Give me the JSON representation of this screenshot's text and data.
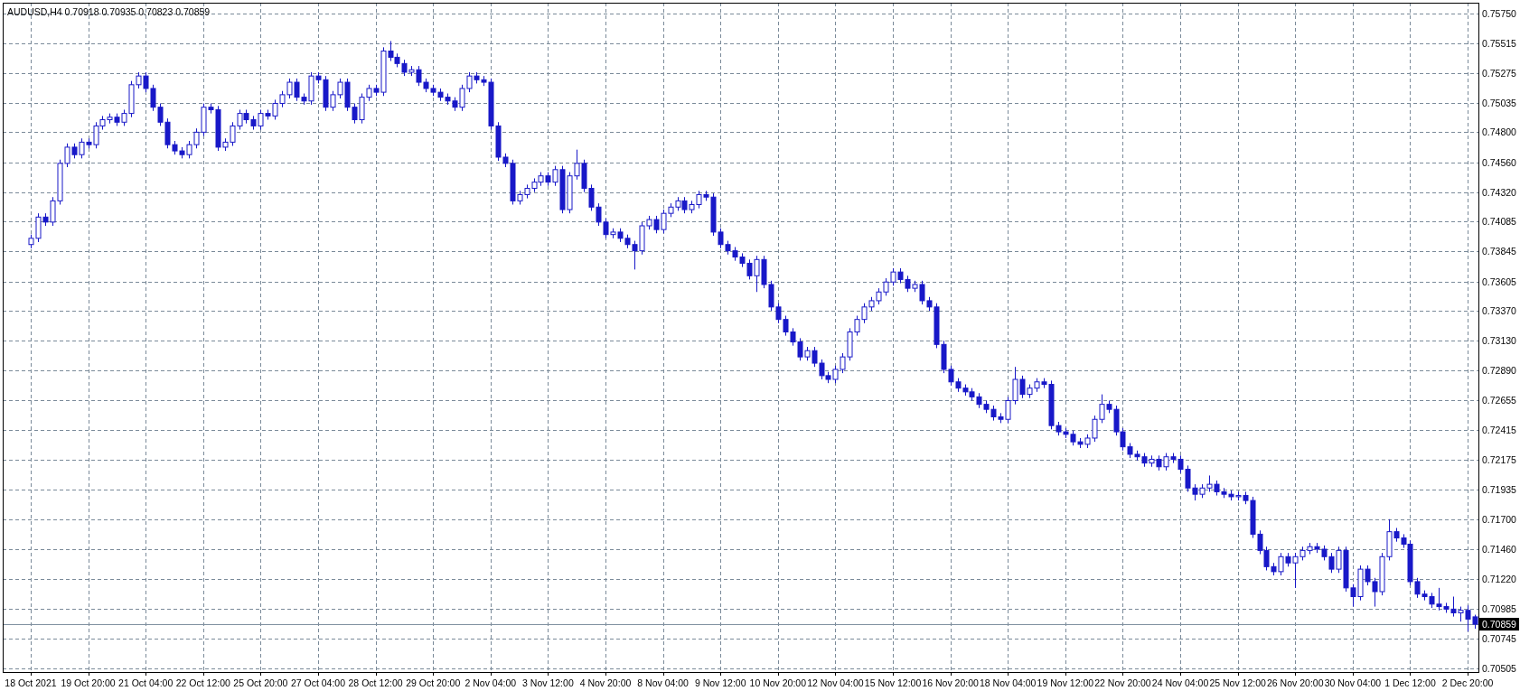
{
  "header_values": "0.70918 0.70935 0.70823 0.70859",
  "chart_data": {
    "type": "candlestick",
    "title": "AUDUSD,H4",
    "grid": true,
    "ylim": [
      0.70476,
      0.75837
    ],
    "ref_lines": [
      {
        "axis": "y",
        "value": 0.70859,
        "label": "0.70859"
      }
    ],
    "yticks": [
      {
        "value": 0.7575,
        "label": "0.75750"
      },
      {
        "value": 0.75515,
        "label": "0.75515"
      },
      {
        "value": 0.75275,
        "label": "0.75275"
      },
      {
        "value": 0.75035,
        "label": "0.75035"
      },
      {
        "value": 0.748,
        "label": "0.74800"
      },
      {
        "value": 0.7456,
        "label": "0.74560"
      },
      {
        "value": 0.7432,
        "label": "0.74320"
      },
      {
        "value": 0.74085,
        "label": "0.74085"
      },
      {
        "value": 0.73845,
        "label": "0.73845"
      },
      {
        "value": 0.73605,
        "label": "0.73605"
      },
      {
        "value": 0.7337,
        "label": "0.73370"
      },
      {
        "value": 0.7313,
        "label": "0.73130"
      },
      {
        "value": 0.7289,
        "label": "0.72890"
      },
      {
        "value": 0.72655,
        "label": "0.72655"
      },
      {
        "value": 0.72415,
        "label": "0.72415"
      },
      {
        "value": 0.72175,
        "label": "0.72175"
      },
      {
        "value": 0.71935,
        "label": "0.71935"
      },
      {
        "value": 0.717,
        "label": "0.71700"
      },
      {
        "value": 0.7146,
        "label": "0.71460"
      },
      {
        "value": 0.7122,
        "label": "0.71220"
      },
      {
        "value": 0.70985,
        "label": "0.70985"
      },
      {
        "value": 0.70745,
        "label": "0.70745"
      },
      {
        "value": 0.70505,
        "label": "0.70505"
      }
    ],
    "categories": [
      "18 Oct 2021",
      null,
      null,
      null,
      null,
      null,
      null,
      null,
      "19 Oct 20:00",
      null,
      null,
      null,
      null,
      null,
      null,
      null,
      "21 Oct 04:00",
      null,
      null,
      null,
      null,
      null,
      null,
      null,
      "22 Oct 12:00",
      null,
      null,
      null,
      null,
      null,
      null,
      null,
      "25 Oct 20:00",
      null,
      null,
      null,
      null,
      null,
      null,
      null,
      "27 Oct 04:00",
      null,
      null,
      null,
      null,
      null,
      null,
      null,
      "28 Oct 12:00",
      null,
      null,
      null,
      null,
      null,
      null,
      null,
      "29 Oct 20:00",
      null,
      null,
      null,
      null,
      null,
      null,
      null,
      "2 Nov 04:00",
      null,
      null,
      null,
      null,
      null,
      null,
      null,
      "3 Nov 12:00",
      null,
      null,
      null,
      null,
      null,
      null,
      null,
      "4 Nov 20:00",
      null,
      null,
      null,
      null,
      null,
      null,
      null,
      "8 Nov 04:00",
      null,
      null,
      null,
      null,
      null,
      null,
      null,
      "9 Nov 12:00",
      null,
      null,
      null,
      null,
      null,
      null,
      null,
      "10 Nov 20:00",
      null,
      null,
      null,
      null,
      null,
      null,
      null,
      "12 Nov 04:00",
      null,
      null,
      null,
      null,
      null,
      null,
      null,
      "15 Nov 12:00",
      null,
      null,
      null,
      null,
      null,
      null,
      null,
      "16 Nov 20:00",
      null,
      null,
      null,
      null,
      null,
      null,
      null,
      "18 Nov 04:00",
      null,
      null,
      null,
      null,
      null,
      null,
      null,
      "19 Nov 12:00",
      null,
      null,
      null,
      null,
      null,
      null,
      null,
      "22 Nov 20:00",
      null,
      null,
      null,
      null,
      null,
      null,
      null,
      "24 Nov 04:00",
      null,
      null,
      null,
      null,
      null,
      null,
      null,
      "25 Nov 12:00",
      null,
      null,
      null,
      null,
      null,
      null,
      null,
      "26 Nov 20:00",
      null,
      null,
      null,
      null,
      null,
      null,
      null,
      "30 Nov 04:00",
      null,
      null,
      null,
      null,
      null,
      null,
      null,
      "1 Dec 12:00",
      null,
      null,
      null,
      null,
      null,
      null,
      null,
      "2 Dec 20:00",
      null
    ],
    "ohlc": [
      [
        0.739,
        0.7398,
        0.7387,
        0.7395
      ],
      [
        0.7395,
        0.7415,
        0.7392,
        0.7412
      ],
      [
        0.7412,
        0.7415,
        0.7405,
        0.7408
      ],
      [
        0.7408,
        0.7428,
        0.7405,
        0.7425
      ],
      [
        0.7425,
        0.7458,
        0.7422,
        0.7455
      ],
      [
        0.7455,
        0.7471,
        0.7452,
        0.7468
      ],
      [
        0.7468,
        0.7471,
        0.7459,
        0.7462
      ],
      [
        0.7462,
        0.7475,
        0.7459,
        0.7472
      ],
      [
        0.7472,
        0.7475,
        0.7467,
        0.747
      ],
      [
        0.747,
        0.7488,
        0.7467,
        0.7485
      ],
      [
        0.7485,
        0.7493,
        0.7482,
        0.749
      ],
      [
        0.749,
        0.7495,
        0.7487,
        0.7492
      ],
      [
        0.7492,
        0.7495,
        0.7485,
        0.7488
      ],
      [
        0.7488,
        0.7498,
        0.7485,
        0.7495
      ],
      [
        0.7495,
        0.7521,
        0.7492,
        0.7518
      ],
      [
        0.7518,
        0.7528,
        0.7515,
        0.7525
      ],
      [
        0.7525,
        0.7528,
        0.7512,
        0.7515
      ],
      [
        0.7515,
        0.7518,
        0.7497,
        0.75
      ],
      [
        0.75,
        0.7503,
        0.7485,
        0.7488
      ],
      [
        0.7488,
        0.7491,
        0.7467,
        0.747
      ],
      [
        0.747,
        0.7473,
        0.7462,
        0.7465
      ],
      [
        0.7465,
        0.7468,
        0.7459,
        0.7462
      ],
      [
        0.7462,
        0.7473,
        0.7459,
        0.747
      ],
      [
        0.747,
        0.7483,
        0.7467,
        0.748
      ],
      [
        0.748,
        0.7503,
        0.7477,
        0.75
      ],
      [
        0.75,
        0.7503,
        0.7495,
        0.7498
      ],
      [
        0.7498,
        0.7501,
        0.7465,
        0.7468
      ],
      [
        0.7468,
        0.7475,
        0.7465,
        0.7472
      ],
      [
        0.7472,
        0.7488,
        0.7469,
        0.7485
      ],
      [
        0.7485,
        0.7498,
        0.7482,
        0.7495
      ],
      [
        0.7495,
        0.7498,
        0.7487,
        0.749
      ],
      [
        0.749,
        0.7493,
        0.7482,
        0.7485
      ],
      [
        0.7485,
        0.7498,
        0.7482,
        0.7495
      ],
      [
        0.7495,
        0.7498,
        0.749,
        0.7493
      ],
      [
        0.7493,
        0.7506,
        0.749,
        0.7503
      ],
      [
        0.7503,
        0.7513,
        0.75,
        0.751
      ],
      [
        0.751,
        0.7523,
        0.7507,
        0.752
      ],
      [
        0.752,
        0.7523,
        0.7505,
        0.7508
      ],
      [
        0.7508,
        0.7511,
        0.7502,
        0.7505
      ],
      [
        0.7505,
        0.7528,
        0.7502,
        0.7525
      ],
      [
        0.7525,
        0.7528,
        0.7519,
        0.7522
      ],
      [
        0.7522,
        0.7525,
        0.7497,
        0.75
      ],
      [
        0.75,
        0.7513,
        0.7497,
        0.751
      ],
      [
        0.751,
        0.7523,
        0.7507,
        0.752
      ],
      [
        0.752,
        0.7523,
        0.7497,
        0.75
      ],
      [
        0.75,
        0.7503,
        0.7487,
        0.749
      ],
      [
        0.749,
        0.7511,
        0.7487,
        0.7508
      ],
      [
        0.7508,
        0.7518,
        0.7505,
        0.7515
      ],
      [
        0.7515,
        0.7518,
        0.7509,
        0.7512
      ],
      [
        0.7512,
        0.7548,
        0.7509,
        0.7545
      ],
      [
        0.7545,
        0.7553,
        0.7537,
        0.754
      ],
      [
        0.754,
        0.7543,
        0.7532,
        0.7535
      ],
      [
        0.7535,
        0.7538,
        0.7525,
        0.7528
      ],
      [
        0.7528,
        0.7533,
        0.7525,
        0.753
      ],
      [
        0.753,
        0.7533,
        0.7517,
        0.752
      ],
      [
        0.752,
        0.7523,
        0.7512,
        0.7515
      ],
      [
        0.7515,
        0.7518,
        0.7509,
        0.7512
      ],
      [
        0.7512,
        0.7515,
        0.7505,
        0.7508
      ],
      [
        0.7508,
        0.7511,
        0.7502,
        0.7505
      ],
      [
        0.7505,
        0.7508,
        0.7497,
        0.75
      ],
      [
        0.75,
        0.7518,
        0.7497,
        0.7515
      ],
      [
        0.7515,
        0.7528,
        0.7512,
        0.7525
      ],
      [
        0.7525,
        0.7528,
        0.7519,
        0.7522
      ],
      [
        0.7522,
        0.7525,
        0.7517,
        0.752
      ],
      [
        0.752,
        0.7523,
        0.7482,
        0.7485
      ],
      [
        0.7485,
        0.7488,
        0.7457,
        0.746
      ],
      [
        0.746,
        0.7463,
        0.7452,
        0.7455
      ],
      [
        0.7455,
        0.7458,
        0.7422,
        0.7425
      ],
      [
        0.7425,
        0.7433,
        0.7422,
        0.743
      ],
      [
        0.743,
        0.7438,
        0.7427,
        0.7435
      ],
      [
        0.7435,
        0.7443,
        0.7432,
        0.744
      ],
      [
        0.744,
        0.7448,
        0.7437,
        0.7445
      ],
      [
        0.7445,
        0.7448,
        0.7437,
        0.744
      ],
      [
        0.744,
        0.7453,
        0.7437,
        0.745
      ],
      [
        0.745,
        0.7453,
        0.7415,
        0.7418
      ],
      [
        0.7418,
        0.7448,
        0.7415,
        0.7445
      ],
      [
        0.7445,
        0.7466,
        0.7442,
        0.7455
      ],
      [
        0.7455,
        0.7458,
        0.7432,
        0.7435
      ],
      [
        0.7435,
        0.7438,
        0.7417,
        0.742
      ],
      [
        0.742,
        0.7423,
        0.7405,
        0.7408
      ],
      [
        0.7408,
        0.7411,
        0.7395,
        0.7398
      ],
      [
        0.7398,
        0.7403,
        0.7395,
        0.74
      ],
      [
        0.74,
        0.7403,
        0.7392,
        0.7395
      ],
      [
        0.7395,
        0.7398,
        0.7387,
        0.739
      ],
      [
        0.739,
        0.7393,
        0.737,
        0.7385
      ],
      [
        0.7385,
        0.7408,
        0.7382,
        0.7405
      ],
      [
        0.7405,
        0.7413,
        0.7402,
        0.741
      ],
      [
        0.741,
        0.7413,
        0.7399,
        0.7402
      ],
      [
        0.7402,
        0.7418,
        0.7399,
        0.7415
      ],
      [
        0.7415,
        0.7423,
        0.7412,
        0.742
      ],
      [
        0.742,
        0.7428,
        0.7417,
        0.7425
      ],
      [
        0.7425,
        0.7428,
        0.7415,
        0.7418
      ],
      [
        0.7418,
        0.7425,
        0.7415,
        0.7422
      ],
      [
        0.7422,
        0.7433,
        0.7419,
        0.743
      ],
      [
        0.743,
        0.7433,
        0.7425,
        0.7428
      ],
      [
        0.7428,
        0.7431,
        0.7397,
        0.74
      ],
      [
        0.74,
        0.7403,
        0.7387,
        0.739
      ],
      [
        0.739,
        0.7393,
        0.7382,
        0.7385
      ],
      [
        0.7385,
        0.7388,
        0.7377,
        0.738
      ],
      [
        0.738,
        0.7383,
        0.7372,
        0.7375
      ],
      [
        0.7375,
        0.7378,
        0.7362,
        0.7365
      ],
      [
        0.7365,
        0.7381,
        0.7352,
        0.7378
      ],
      [
        0.7378,
        0.7381,
        0.7355,
        0.7358
      ],
      [
        0.7358,
        0.7361,
        0.7337,
        0.734
      ],
      [
        0.734,
        0.7343,
        0.7327,
        0.733
      ],
      [
        0.733,
        0.7333,
        0.7317,
        0.732
      ],
      [
        0.732,
        0.7323,
        0.7309,
        0.7312
      ],
      [
        0.7312,
        0.7315,
        0.7297,
        0.73
      ],
      [
        0.73,
        0.7308,
        0.7297,
        0.7305
      ],
      [
        0.7305,
        0.7308,
        0.7292,
        0.7295
      ],
      [
        0.7295,
        0.7298,
        0.7282,
        0.7285
      ],
      [
        0.7285,
        0.7288,
        0.7279,
        0.7282
      ],
      [
        0.7282,
        0.7293,
        0.7279,
        0.729
      ],
      [
        0.729,
        0.7303,
        0.7287,
        0.73
      ],
      [
        0.73,
        0.7323,
        0.7297,
        0.732
      ],
      [
        0.732,
        0.7333,
        0.7317,
        0.733
      ],
      [
        0.733,
        0.7343,
        0.7327,
        0.734
      ],
      [
        0.734,
        0.7348,
        0.7337,
        0.7345
      ],
      [
        0.7345,
        0.7355,
        0.7342,
        0.7352
      ],
      [
        0.7352,
        0.7363,
        0.7349,
        0.736
      ],
      [
        0.736,
        0.7371,
        0.7357,
        0.7368
      ],
      [
        0.7368,
        0.7371,
        0.7359,
        0.7362
      ],
      [
        0.7362,
        0.7365,
        0.7352,
        0.7355
      ],
      [
        0.7355,
        0.7361,
        0.7352,
        0.7358
      ],
      [
        0.7358,
        0.7361,
        0.7342,
        0.7345
      ],
      [
        0.7345,
        0.7348,
        0.7337,
        0.734
      ],
      [
        0.734,
        0.7343,
        0.7307,
        0.731
      ],
      [
        0.731,
        0.7313,
        0.7287,
        0.729
      ],
      [
        0.729,
        0.7293,
        0.7277,
        0.728
      ],
      [
        0.728,
        0.7283,
        0.7272,
        0.7275
      ],
      [
        0.7275,
        0.7278,
        0.7269,
        0.7272
      ],
      [
        0.7272,
        0.7275,
        0.7265,
        0.7268
      ],
      [
        0.7268,
        0.7271,
        0.7259,
        0.7262
      ],
      [
        0.7262,
        0.7265,
        0.7255,
        0.7258
      ],
      [
        0.7258,
        0.7261,
        0.7249,
        0.7252
      ],
      [
        0.7252,
        0.7255,
        0.7247,
        0.725
      ],
      [
        0.725,
        0.7268,
        0.7247,
        0.7265
      ],
      [
        0.7265,
        0.7292,
        0.7262,
        0.7282
      ],
      [
        0.7282,
        0.7285,
        0.7267,
        0.727
      ],
      [
        0.727,
        0.7278,
        0.7267,
        0.7275
      ],
      [
        0.7275,
        0.7283,
        0.7272,
        0.728
      ],
      [
        0.728,
        0.7283,
        0.7275,
        0.7278
      ],
      [
        0.7278,
        0.7281,
        0.7242,
        0.7245
      ],
      [
        0.7245,
        0.7248,
        0.7237,
        0.724
      ],
      [
        0.724,
        0.7243,
        0.7235,
        0.7238
      ],
      [
        0.7238,
        0.7241,
        0.7229,
        0.7232
      ],
      [
        0.7232,
        0.7235,
        0.7227,
        0.723
      ],
      [
        0.723,
        0.7238,
        0.7227,
        0.7235
      ],
      [
        0.7235,
        0.7253,
        0.7232,
        0.725
      ],
      [
        0.725,
        0.727,
        0.7247,
        0.7262
      ],
      [
        0.7262,
        0.7265,
        0.7255,
        0.7258
      ],
      [
        0.7258,
        0.7261,
        0.7237,
        0.724
      ],
      [
        0.724,
        0.7243,
        0.7225,
        0.7228
      ],
      [
        0.7228,
        0.7231,
        0.7219,
        0.7222
      ],
      [
        0.7222,
        0.7225,
        0.7217,
        0.722
      ],
      [
        0.722,
        0.7223,
        0.7212,
        0.7215
      ],
      [
        0.7215,
        0.7221,
        0.7212,
        0.7218
      ],
      [
        0.7218,
        0.7221,
        0.7209,
        0.7212
      ],
      [
        0.7212,
        0.7223,
        0.7209,
        0.722
      ],
      [
        0.722,
        0.7223,
        0.7215,
        0.7218
      ],
      [
        0.7218,
        0.7221,
        0.7207,
        0.721
      ],
      [
        0.721,
        0.7213,
        0.7192,
        0.7195
      ],
      [
        0.7195,
        0.7198,
        0.7185,
        0.719
      ],
      [
        0.719,
        0.7198,
        0.7187,
        0.7195
      ],
      [
        0.7195,
        0.7205,
        0.7192,
        0.7198
      ],
      [
        0.7198,
        0.7201,
        0.7189,
        0.7192
      ],
      [
        0.7192,
        0.7195,
        0.7187,
        0.719
      ],
      [
        0.719,
        0.7193,
        0.7185,
        0.7188
      ],
      [
        0.7188,
        0.7192,
        0.7185,
        0.7189
      ],
      [
        0.7189,
        0.7192,
        0.7182,
        0.7185
      ],
      [
        0.7185,
        0.7188,
        0.7155,
        0.7158
      ],
      [
        0.7158,
        0.7161,
        0.7142,
        0.7145
      ],
      [
        0.7145,
        0.7148,
        0.7129,
        0.7132
      ],
      [
        0.7132,
        0.7135,
        0.7125,
        0.7128
      ],
      [
        0.7128,
        0.7143,
        0.7125,
        0.714
      ],
      [
        0.714,
        0.7143,
        0.7132,
        0.7135
      ],
      [
        0.7135,
        0.7143,
        0.7115,
        0.714
      ],
      [
        0.714,
        0.7148,
        0.7137,
        0.7145
      ],
      [
        0.7145,
        0.7151,
        0.7142,
        0.7148
      ],
      [
        0.7148,
        0.7151,
        0.7143,
        0.7146
      ],
      [
        0.7146,
        0.7149,
        0.7137,
        0.714
      ],
      [
        0.714,
        0.7143,
        0.7127,
        0.713
      ],
      [
        0.713,
        0.7148,
        0.7127,
        0.7145
      ],
      [
        0.7145,
        0.7148,
        0.7112,
        0.7115
      ],
      [
        0.7115,
        0.7118,
        0.71,
        0.7108
      ],
      [
        0.7108,
        0.7133,
        0.7105,
        0.713
      ],
      [
        0.713,
        0.7133,
        0.7117,
        0.712
      ],
      [
        0.712,
        0.7123,
        0.71,
        0.7112
      ],
      [
        0.7112,
        0.7143,
        0.7109,
        0.714
      ],
      [
        0.714,
        0.717,
        0.7137,
        0.716
      ],
      [
        0.716,
        0.7163,
        0.7152,
        0.7155
      ],
      [
        0.7155,
        0.7158,
        0.7147,
        0.715
      ],
      [
        0.715,
        0.7153,
        0.7117,
        0.712
      ],
      [
        0.712,
        0.7123,
        0.7107,
        0.711
      ],
      [
        0.711,
        0.7113,
        0.7105,
        0.7108
      ],
      [
        0.7108,
        0.7111,
        0.7099,
        0.7102
      ],
      [
        0.7102,
        0.7115,
        0.7097,
        0.71
      ],
      [
        0.71,
        0.7103,
        0.7095,
        0.7098
      ],
      [
        0.7098,
        0.7108,
        0.7092,
        0.7095
      ],
      [
        0.7095,
        0.71,
        0.7088,
        0.7097
      ],
      [
        0.7097,
        0.7101,
        0.708,
        0.709
      ],
      [
        0.70918,
        0.70935,
        0.70823,
        0.70859
      ]
    ]
  }
}
